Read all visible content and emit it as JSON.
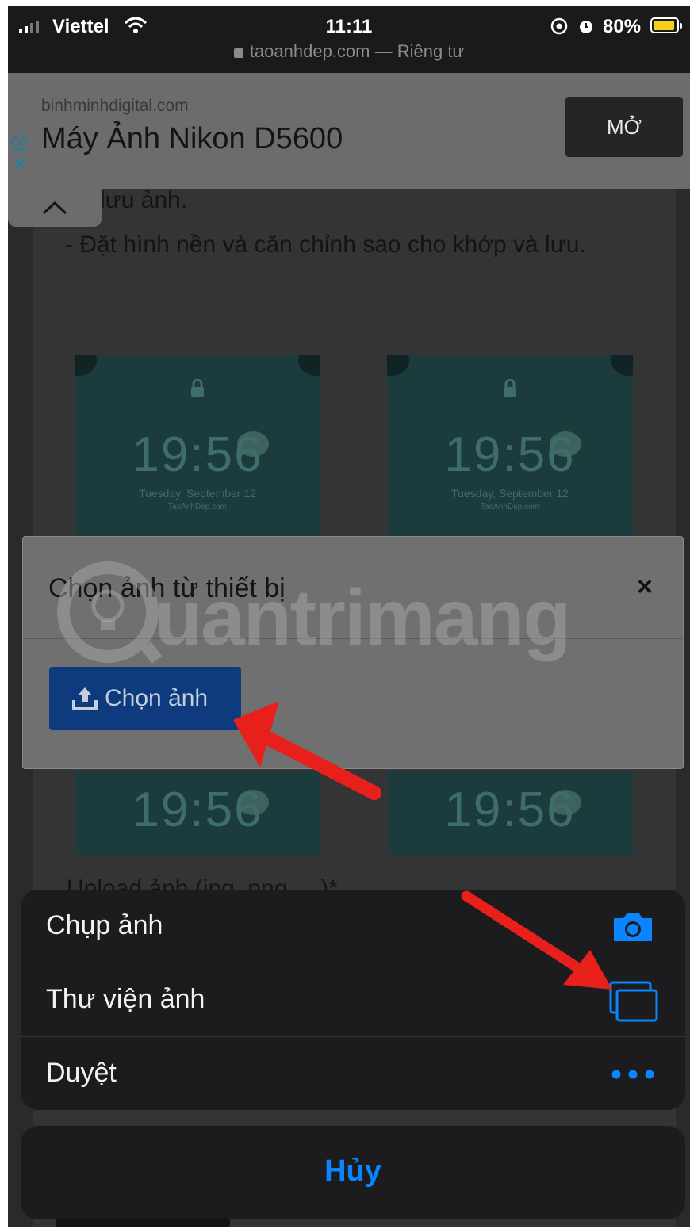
{
  "status_bar": {
    "carrier": "Viettel",
    "time": "11:11",
    "battery": "80%",
    "url": "taoanhdep.com — Riêng tư"
  },
  "ad": {
    "domain": "binhminhdigital.com",
    "title": "Máy Ảnh Nikon D5600",
    "button": "MỞ"
  },
  "article": {
    "line1": "lưu ảnh.",
    "line2": "- Đặt hình nền và căn chỉnh sao cho khớp và lưu.",
    "wallpaper_time": "19:56",
    "wallpaper_date": "Tuesday, September 12",
    "wallpaper_site": "TaoAnhDep.com",
    "behind_text": "Upload ảnh (jpg, png, ...)*"
  },
  "modal": {
    "title": "Chọn ảnh từ thiết bị",
    "close": "×",
    "button": "Chọn ảnh"
  },
  "watermark": "uantrimang",
  "action_sheet": {
    "items": [
      {
        "label": "Chụp ảnh",
        "icon": "camera-icon"
      },
      {
        "label": "Thư viện ảnh",
        "icon": "photo-library-icon"
      },
      {
        "label": "Duyệt",
        "icon": "more-icon"
      }
    ],
    "cancel": "Hủy"
  },
  "colors": {
    "accent_blue": "#0a84ff",
    "arrow_red": "#e8201c",
    "modal_button": "#0d3b7e"
  }
}
